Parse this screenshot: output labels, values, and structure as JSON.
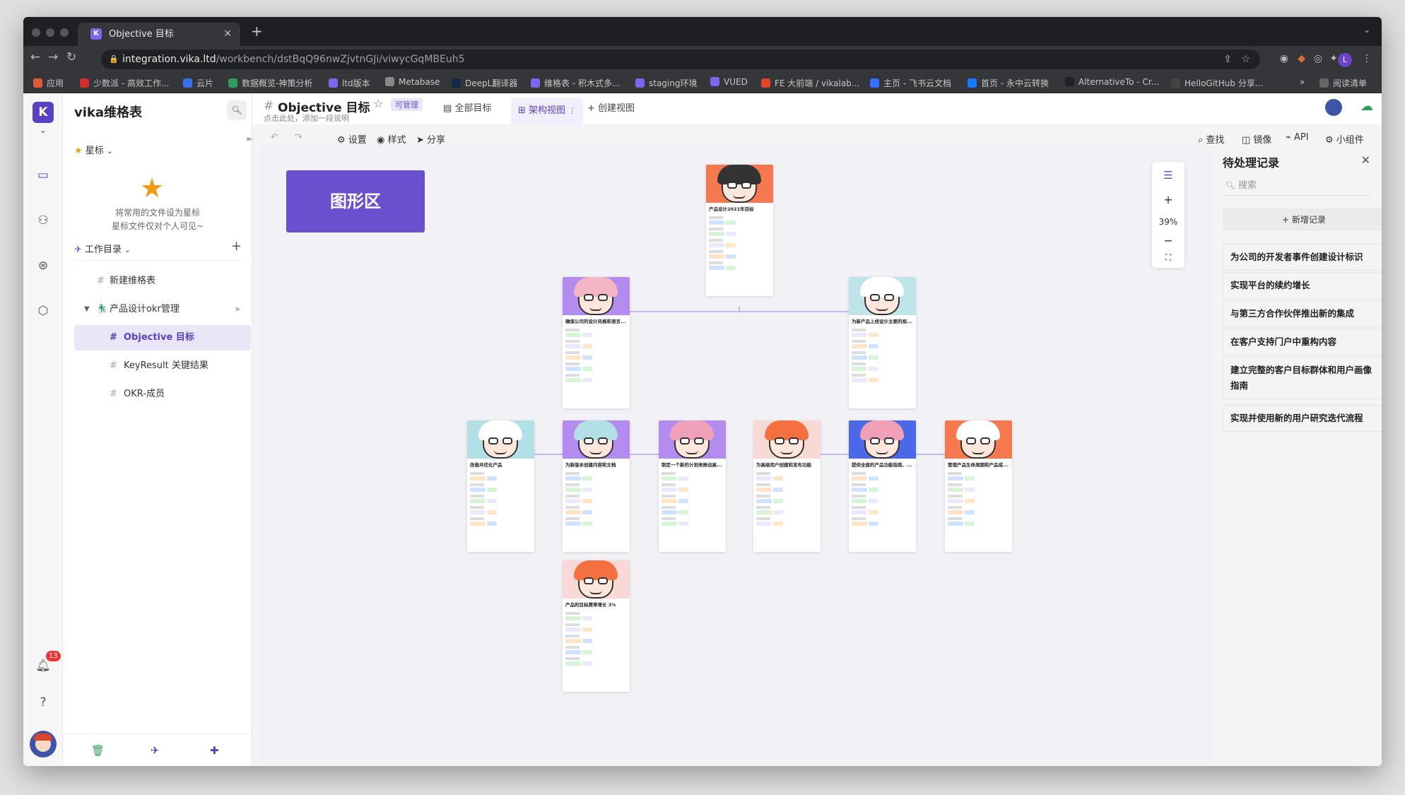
{
  "browser": {
    "tab_title": "Objective 目标",
    "url_host": "integration.vika.ltd",
    "url_path": "/workbench/dstBqQ96nwZjvtnGJi/viwycGqMBEuh5",
    "profile_initial": "L",
    "bookmarks": [
      "应用",
      "少数派 - 高效工作...",
      "云片",
      "数据概览-神策分析",
      "ltd版本",
      "Metabase",
      "DeepL翻译器",
      "维格表 - 积木式多...",
      "staging环境",
      "VUED",
      "FE 大前端 / vikalab...",
      "主页 - 飞书云文档",
      "首页 - 永中云转换",
      "AlternativeTo - Cr...",
      "HelloGitHub 分享...",
      "阅读清单"
    ]
  },
  "sidebar": {
    "space_title": "vika维格表",
    "star_header": "星标",
    "star_tip_1": "将常用的文件设为星标",
    "star_tip_2": "星标文件仅对个人可见~",
    "workspace_header": "工作目录",
    "items": [
      {
        "label": "新建维格表"
      },
      {
        "label": "产品设计okr管理"
      },
      {
        "label": "Objective 目标"
      },
      {
        "label": "KeyResult 关键结果"
      },
      {
        "label": "OKR-成员"
      }
    ],
    "notifications": "13"
  },
  "header": {
    "title": "Objective 目标",
    "permission": "可管理",
    "description": "点击此处，添加一段说明",
    "views": [
      "全部目标",
      "架构视图",
      "创建视图"
    ]
  },
  "toolbar": {
    "settings": "设置",
    "style": "样式",
    "share": "分享",
    "find": "查找",
    "mirror": "镜像",
    "api": "API",
    "widget": "小组件"
  },
  "graph": {
    "label": "图形区",
    "zoom": "39%",
    "cards": [
      {
        "title": "产品设计2021年目标"
      },
      {
        "title": "确保公司的设计风格和语言..."
      },
      {
        "title": "为新产品上线设计主要的视..."
      },
      {
        "title": "改善并优化产品"
      },
      {
        "title": "为新版本创建内容和文档"
      },
      {
        "title": "制定一个新的计划来推动高..."
      },
      {
        "title": "为高级用户创建和发布功能"
      },
      {
        "title": "提供全面的产品功能指南、..."
      },
      {
        "title": "管理产品生命周期和产品成..."
      },
      {
        "title": "产品的目标费率增长 3%"
      }
    ]
  },
  "records": {
    "title": "待处理记录",
    "search_placeholder": "搜索",
    "add_label": "新增记录",
    "items": [
      "为公司的开发者事件创建设计标识",
      "实现平台的续约增长",
      "与第三方合作伙伴推出新的集成",
      "在客户支持门户中重构内容",
      "建立完整的客户目标群体和用户画像指南",
      "实现并使用新的用户研究迭代流程"
    ]
  },
  "colors": {
    "accent": "#7b67ee",
    "graph_label": "#6a4fcf"
  }
}
